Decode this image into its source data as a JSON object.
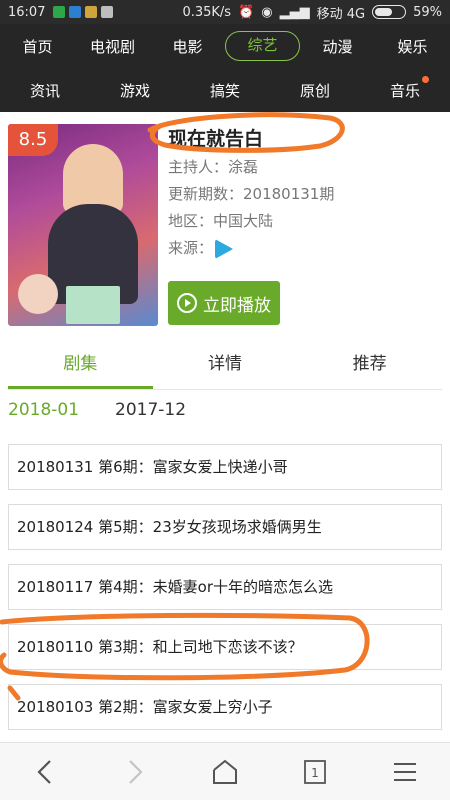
{
  "status": {
    "time": "16:07",
    "speed": "0.35K/s",
    "carrier": "移动 4G",
    "battery": "59%",
    "battery_level": 0.59,
    "icons": [
      "green-app-icon",
      "blue-app-icon",
      "notification-icon",
      "alarm-icon",
      "wifi-icon",
      "signal-icon"
    ]
  },
  "nav": {
    "row1": [
      "首页",
      "电视剧",
      "电影",
      "综艺",
      "动漫",
      "娱乐"
    ],
    "row2": [
      "资讯",
      "游戏",
      "搞笑",
      "原创",
      "音乐"
    ],
    "active": "综艺",
    "accent_color": "#6aaa2a"
  },
  "show": {
    "rating": "8.5",
    "title": "现在就告白",
    "host": "主持人：涂磊",
    "update": "更新期数：20180131期",
    "region": "地区：中国大陆",
    "source_label": "来源：",
    "play_label": "立即播放"
  },
  "tabs": [
    "剧集",
    "详情",
    "推荐"
  ],
  "years": [
    "2018-01",
    "2017-12"
  ],
  "episodes": [
    "20180131 第6期：富家女爱上快递小哥",
    "20180124 第5期：23岁女孩现场求婚俩男生",
    "20180117 第4期：未婚妻or十年的暗恋怎么选",
    "20180110 第3期：和上司地下恋该不该？",
    "20180103 第2期：富家女爱上穷小子"
  ],
  "bottom": [
    "back-icon",
    "forward-icon",
    "home-icon",
    "tabs-icon",
    "menu-icon"
  ],
  "tabs_count": "1",
  "annotation_color": "#f07a2a"
}
